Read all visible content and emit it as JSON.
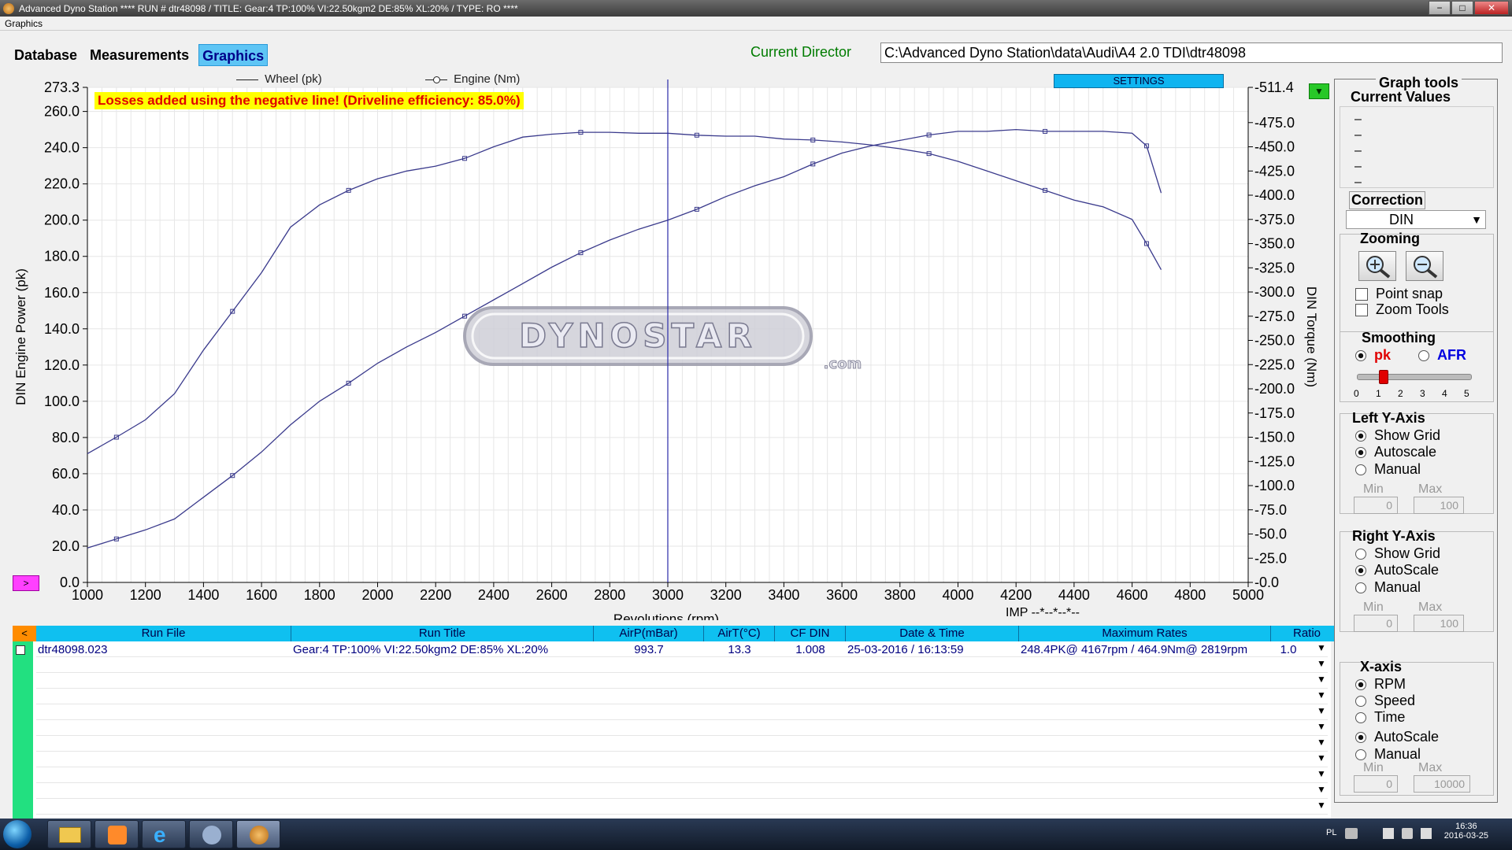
{
  "window": {
    "title": "Advanced Dyno Station  **** RUN # dtr48098  /  TITLE: Gear:4 TP:100% VI:22.50kgm2 DE:85% XL:20%  /  TYPE: RO ****",
    "menu": "Graphics",
    "controls": {
      "minimize": "−",
      "maximize": "□",
      "close": "✕"
    }
  },
  "tabs": [
    {
      "label": "Database"
    },
    {
      "label": "Measurements"
    },
    {
      "label": "Graphics",
      "active": true
    }
  ],
  "directory": {
    "label": "Current Director",
    "value": "C:\\Advanced Dyno Station\\data\\Audi\\A4 2.0 TDI\\dtr48098"
  },
  "banner": "Losses added using the negative line! (Driveline efficiency: 85.0%)",
  "legend": {
    "wheel": "Wheel  (pk)",
    "engine": "Engine (Nm)"
  },
  "settings_label": "SETTINGS",
  "watermark": "DYNOSTAR",
  "watermark_sub": ".com",
  "imp_readout": "IMP --*--*--*--",
  "chart_data": {
    "type": "line",
    "xlabel": "Revolutions (rpm)",
    "ylabel": "DIN Engine Power (pk)",
    "y2label": "DIN Torque (Nm)",
    "xlim": [
      1000,
      5000
    ],
    "ylim": [
      0,
      273.3
    ],
    "y2lim": [
      0,
      511.4
    ],
    "x_ticks": [
      "1000",
      "1200",
      "1400",
      "1600",
      "1800",
      "2000",
      "2200",
      "2400",
      "2600",
      "2800",
      "3000",
      "3200",
      "3400",
      "3600",
      "3800",
      "4000",
      "4200",
      "4400",
      "4600",
      "4800",
      "5000"
    ],
    "y_ticks": [
      {
        "label": "273.3",
        "value": 273.3
      },
      {
        "label": "260.0",
        "value": 260
      },
      {
        "label": "240.0",
        "value": 240
      },
      {
        "label": "220.0",
        "value": 220
      },
      {
        "label": "200.0",
        "value": 200
      },
      {
        "label": "180.0",
        "value": 180
      },
      {
        "label": "160.0",
        "value": 160
      },
      {
        "label": "140.0",
        "value": 140
      },
      {
        "label": "120.0",
        "value": 120
      },
      {
        "label": "100.0",
        "value": 100
      },
      {
        "label": "80.0",
        "value": 80
      },
      {
        "label": "60.0",
        "value": 60
      },
      {
        "label": "40.0",
        "value": 40
      },
      {
        "label": "20.0",
        "value": 20
      },
      {
        "label": "0.0",
        "value": 0
      }
    ],
    "y2_ticks": [
      {
        "label": "511.4",
        "value": 511.4
      },
      {
        "label": "475.0",
        "value": 475
      },
      {
        "label": "450.0",
        "value": 450
      },
      {
        "label": "425.0",
        "value": 425
      },
      {
        "label": "400.0",
        "value": 400
      },
      {
        "label": "375.0",
        "value": 375
      },
      {
        "label": "350.0",
        "value": 350
      },
      {
        "label": "325.0",
        "value": 325
      },
      {
        "label": "300.0",
        "value": 300
      },
      {
        "label": "275.0",
        "value": 275
      },
      {
        "label": "250.0",
        "value": 250
      },
      {
        "label": "225.0",
        "value": 225
      },
      {
        "label": "200.0",
        "value": 200
      },
      {
        "label": "175.0",
        "value": 175
      },
      {
        "label": "150.0",
        "value": 150
      },
      {
        "label": "125.0",
        "value": 125
      },
      {
        "label": "100.0",
        "value": 100
      },
      {
        "label": "75.0",
        "value": 75
      },
      {
        "label": "50.0",
        "value": 50
      },
      {
        "label": "25.0",
        "value": 25
      },
      {
        "label": "0.0",
        "value": 0
      }
    ],
    "cursor_x": 3000,
    "series": [
      {
        "name": "Wheel  (pk)",
        "axis": "left",
        "x": [
          1000,
          1100,
          1200,
          1300,
          1400,
          1500,
          1600,
          1700,
          1800,
          1900,
          2000,
          2100,
          2200,
          2300,
          2400,
          2500,
          2600,
          2700,
          2800,
          2900,
          3000,
          3100,
          3200,
          3300,
          3400,
          3500,
          3600,
          3700,
          3800,
          3900,
          4000,
          4100,
          4200,
          4300,
          4400,
          4500,
          4600,
          4650,
          4700
        ],
        "values": [
          19,
          24,
          29,
          35,
          47,
          59,
          72,
          87,
          100,
          110,
          121,
          130,
          138,
          147,
          156,
          165,
          174,
          182,
          189,
          195,
          200,
          206,
          213,
          219,
          224,
          231,
          237,
          241,
          244,
          247,
          249,
          249,
          250,
          249,
          249,
          249,
          248,
          241,
          215
        ]
      },
      {
        "name": "Engine (Nm)",
        "axis": "right",
        "x": [
          1000,
          1100,
          1200,
          1300,
          1400,
          1500,
          1600,
          1700,
          1800,
          1900,
          2000,
          2100,
          2200,
          2300,
          2400,
          2500,
          2600,
          2700,
          2800,
          2900,
          3000,
          3100,
          3200,
          3300,
          3400,
          3500,
          3600,
          3700,
          3800,
          3900,
          4000,
          4100,
          4200,
          4300,
          4400,
          4500,
          4600,
          4650,
          4700
        ],
        "values": [
          133,
          150,
          168,
          195,
          240,
          280,
          320,
          367,
          390,
          405,
          417,
          425,
          430,
          438,
          450,
          460,
          463,
          465,
          465,
          464,
          464,
          462,
          461,
          461,
          458,
          457,
          455,
          452,
          448,
          443,
          435,
          425,
          415,
          405,
          395,
          388,
          375,
          350,
          323
        ]
      }
    ]
  },
  "runs": {
    "columns": [
      {
        "label": "Run File"
      },
      {
        "label": "Run Title"
      },
      {
        "label": "AirP(mBar)"
      },
      {
        "label": "AirT(°C)"
      },
      {
        "label": "CF DIN"
      },
      {
        "label": "Date & Time"
      },
      {
        "label": "Maximum Rates"
      },
      {
        "label": "Ratio"
      }
    ],
    "row": {
      "run_file": "dtr48098.023",
      "run_title": "Gear:4 TP:100% VI:22.50kgm2 DE:85% XL:20%",
      "airp": "993.7",
      "airt": "13.3",
      "cf": "1.008",
      "datetime": "25-03-2016 / 16:13:59",
      "max_rates": "248.4PK@ 4167rpm / 464.9Nm@ 2819rpm",
      "ratio": "1.0"
    },
    "left_button": "<"
  },
  "tools": {
    "title": "Graph tools",
    "current_values": "Current Values",
    "current_value_rows": [
      "–",
      "–",
      "–",
      "–",
      "–"
    ],
    "correction_label": "Correction",
    "correction_value": "DIN",
    "zooming_label": "Zooming",
    "point_snap": "Point snap",
    "zoom_tools": "Zoom Tools",
    "smoothing_label": "Smoothing",
    "smoothing_pk": "pk",
    "smoothing_afr": "AFR",
    "smoothing_level": 1,
    "slider_ticks": [
      "0",
      "1",
      "2",
      "3",
      "4",
      "5"
    ],
    "left_axis": {
      "title": "Left Y-Axis",
      "opts": [
        "Show Grid",
        "Autoscale",
        "Manual"
      ],
      "min_label": "Min",
      "max_label": "Max",
      "min": "0",
      "max": "100"
    },
    "right_axis": {
      "title": "Right Y-Axis",
      "opts": [
        "Show Grid",
        "AutoScale",
        "Manual"
      ],
      "min_label": "Min",
      "max_label": "Max",
      "min": "0",
      "max": "100"
    },
    "x_axis": {
      "title": "X-axis",
      "opts": [
        "RPM",
        "Speed",
        "Time",
        "AutoScale",
        "Manual"
      ],
      "min_label": "Min",
      "max_label": "Max",
      "min": "0",
      "max": "10000"
    }
  },
  "taskbar": {
    "lang": "PL",
    "time": "16:36",
    "date": "2016-03-25"
  }
}
